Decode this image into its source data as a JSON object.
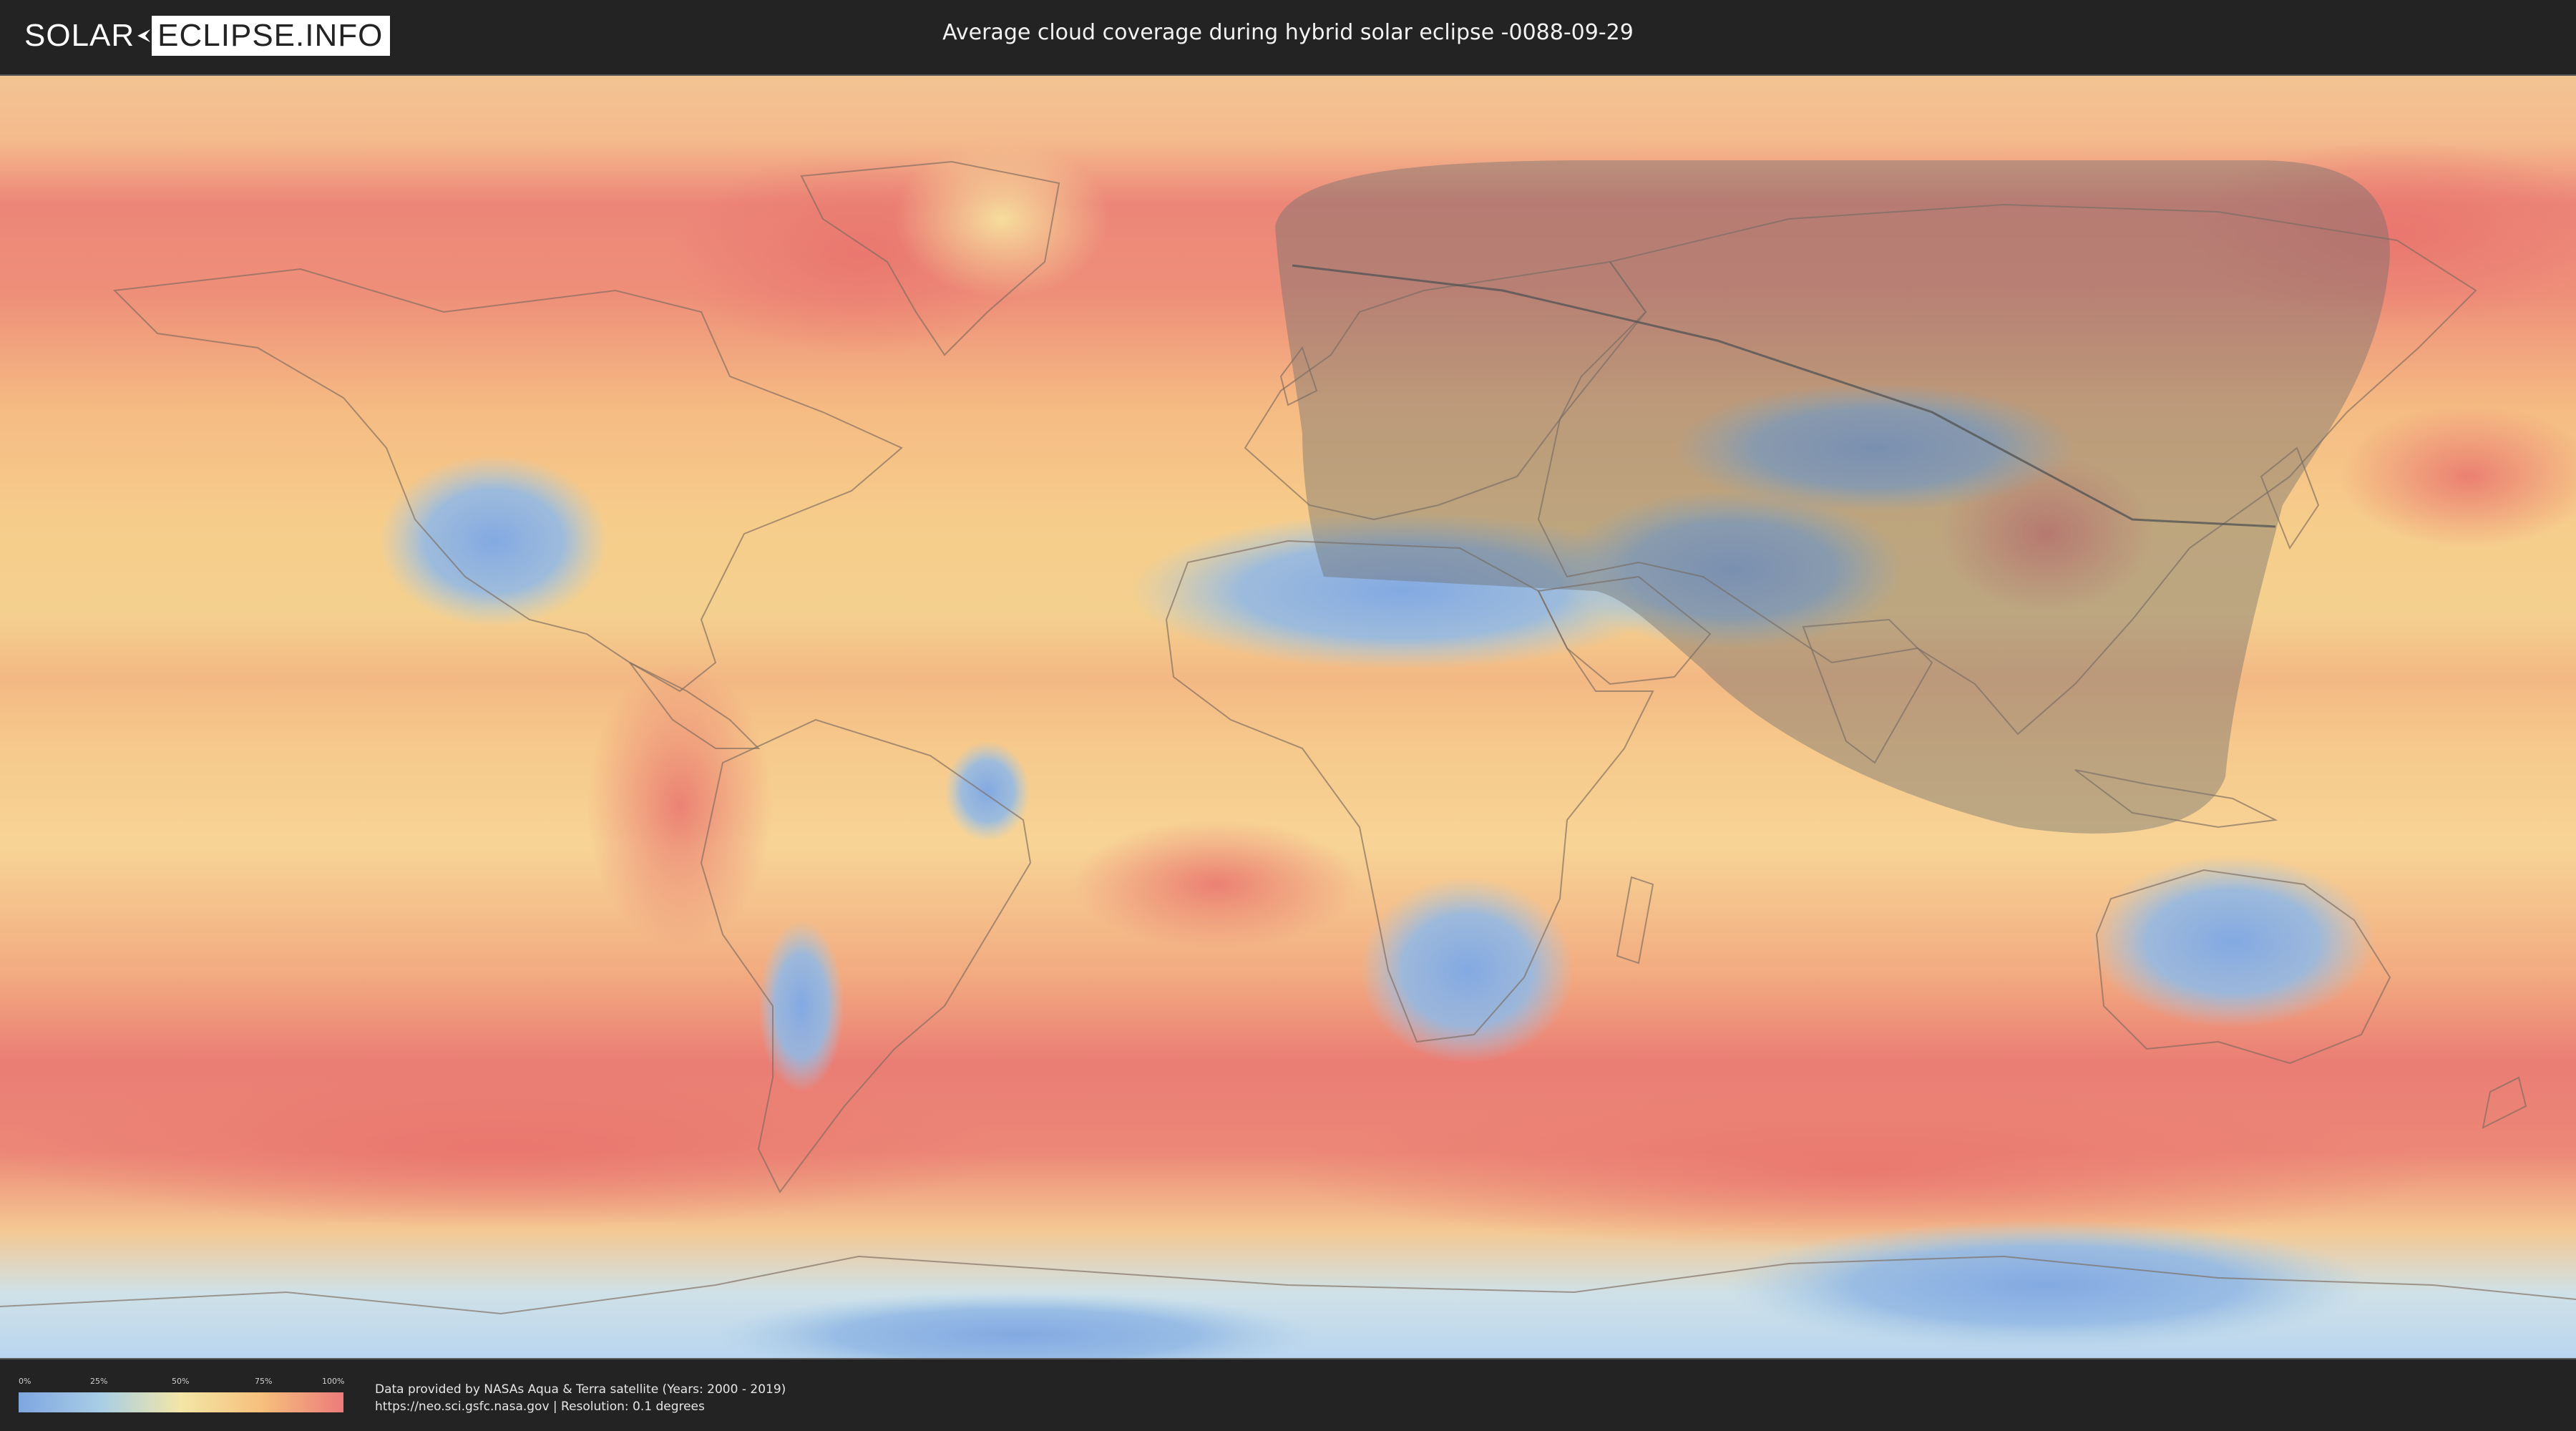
{
  "header": {
    "logo_left": "SOLAR",
    "logo_right": "ECLIPSE.INFO",
    "title": "Average cloud coverage during hybrid solar eclipse -0088-09-29"
  },
  "legend": {
    "ticks": [
      "0%",
      "25%",
      "50%",
      "75%",
      "100%"
    ],
    "colors": [
      "#7ea6e0",
      "#a8cde6",
      "#f3e6a6",
      "#f6bf7c",
      "#ec7b7b"
    ]
  },
  "footer": {
    "credit_line": "Data provided by NASAs Aqua & Terra satellite (Years: 2000 - 2019)",
    "source_line": "https://neo.sci.gsfc.nasa.gov | Resolution: 0.1 degrees"
  },
  "map": {
    "projection": "equirectangular",
    "overlay_color": "#6e6e6e",
    "cloud_low_color": "#86ace2",
    "cloud_high_color": "#ec7e72"
  }
}
